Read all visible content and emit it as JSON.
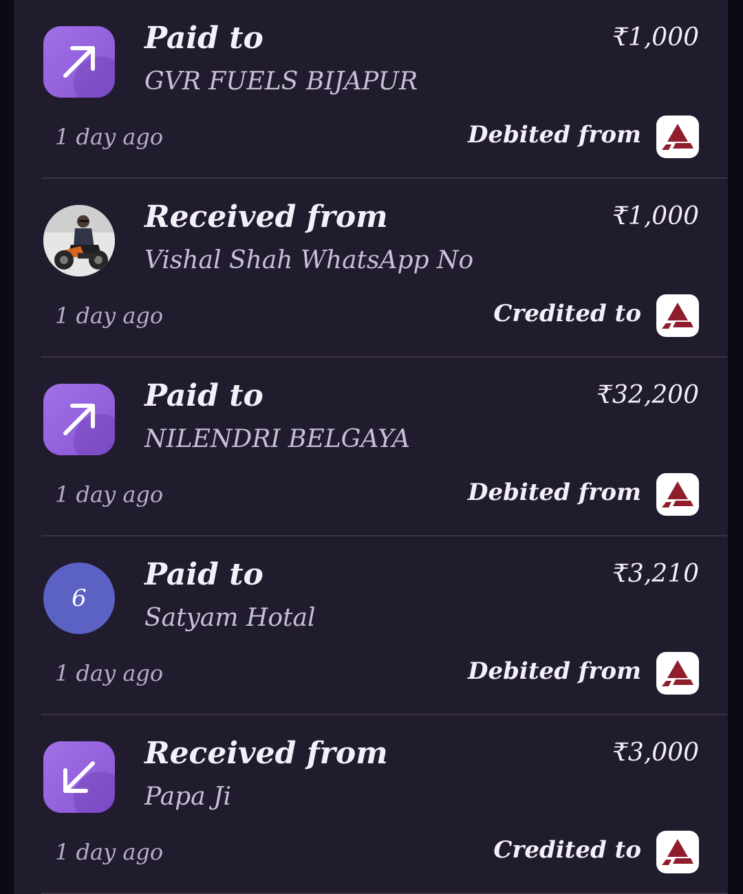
{
  "transactions": [
    {
      "type": "Paid to",
      "name": "GVR FUELS BIJAPUR",
      "amount": "₹1,000",
      "time": "1 day ago",
      "status": "Debited from",
      "avatar": {
        "kind": "arrow-up-right-icon"
      }
    },
    {
      "type": "Received from",
      "name": "Vishal Shah WhatsApp No",
      "amount": "₹1,000",
      "time": "1 day ago",
      "status": "Credited to",
      "avatar": {
        "kind": "profile-photo"
      }
    },
    {
      "type": "Paid to",
      "name": "NILENDRI BELGAYA",
      "amount": "₹32,200",
      "time": "1 day ago",
      "status": "Debited from",
      "avatar": {
        "kind": "arrow-up-right-icon"
      }
    },
    {
      "type": "Paid to",
      "name": "Satyam Hotal",
      "amount": "₹3,210",
      "time": "1 day ago",
      "status": "Debited from",
      "avatar": {
        "kind": "letter",
        "letter": "6"
      }
    },
    {
      "type": "Received from",
      "name": "Papa Ji",
      "amount": "₹3,000",
      "time": "1 day ago",
      "status": "Credited to",
      "avatar": {
        "kind": "arrow-down-left-icon"
      }
    }
  ],
  "bank_icon": "axis-bank-logo-icon",
  "colors": {
    "background": "#211b2e",
    "icon_purple": "#9563dc",
    "letter_avatar": "#5b62c4",
    "bank_logo": "#8f1d2c"
  }
}
